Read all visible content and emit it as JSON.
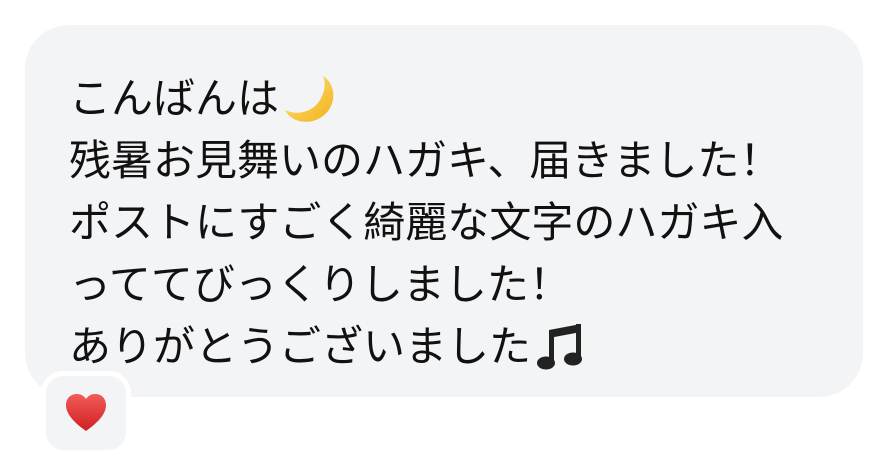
{
  "message": {
    "lines": [
      "こんばんは",
      "残暑お見舞いのハガキ、届きました！",
      "ポストにすごく綺麗な文字のハガキ入",
      "っててびっくりしました！",
      "ありがとうございました"
    ],
    "emojis": [
      "crescent-moon-icon",
      "musical-notes-icon"
    ]
  },
  "reaction": {
    "icon": "heart-icon",
    "color": "#e5312f"
  },
  "colors": {
    "bubble": "#f3f4f6",
    "text": "#111111"
  }
}
